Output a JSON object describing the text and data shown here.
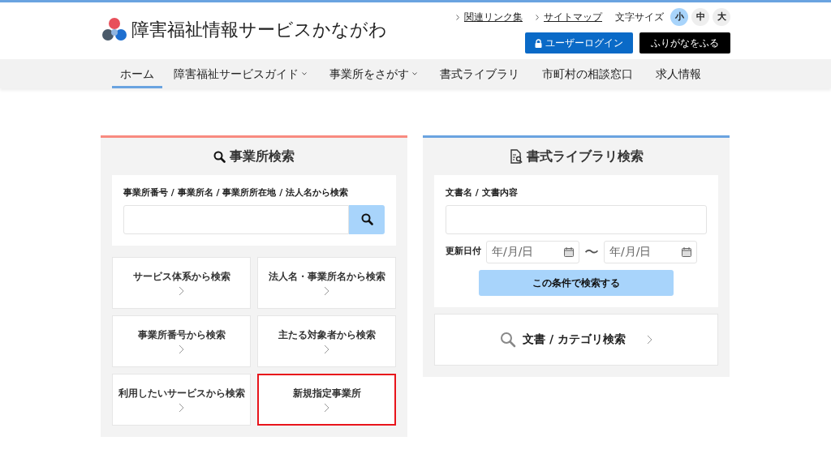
{
  "site_title": "障害福祉情報サービスかながわ",
  "top_links": [
    {
      "label": "関連リンク集"
    },
    {
      "label": "サイトマップ"
    }
  ],
  "font_size": {
    "label": "文字サイズ",
    "options": [
      {
        "label": "小",
        "selected": true
      },
      {
        "label": "中",
        "selected": false
      },
      {
        "label": "大",
        "selected": false
      }
    ]
  },
  "login_button": "ユーザーログイン",
  "furigana_button": "ふりがなをふる",
  "nav": [
    {
      "label": "ホーム",
      "selected": true,
      "dropdown": false
    },
    {
      "label": "障害福祉サービスガイド",
      "selected": false,
      "dropdown": true
    },
    {
      "label": "事業所をさがす",
      "selected": false,
      "dropdown": true
    },
    {
      "label": "書式ライブラリ",
      "selected": false,
      "dropdown": false
    },
    {
      "label": "市町村の相談窓口",
      "selected": false,
      "dropdown": false
    },
    {
      "label": "求人情報",
      "selected": false,
      "dropdown": false
    }
  ],
  "office_search": {
    "title": "事業所検索",
    "field_label": "事業所番号 / 事業所名 / 事業所所在地 / 法人名から検索",
    "tiles": [
      {
        "label": "サービス体系から検索",
        "highlighted": false
      },
      {
        "label": "法人名・事業所名から検索",
        "highlighted": false
      },
      {
        "label": "事業所番号から検索",
        "highlighted": false
      },
      {
        "label": "主たる対象者から検索",
        "highlighted": false
      },
      {
        "label": "利用したいサービスから検索",
        "highlighted": false
      },
      {
        "label": "新規指定事業所",
        "highlighted": true
      }
    ]
  },
  "library_search": {
    "title": "書式ライブラリ検索",
    "field_label": "文書名 / 文書内容",
    "date_label": "更新日付",
    "date_from": {
      "placeholder": "年/月/日"
    },
    "range_mark": "〜",
    "date_to": {
      "placeholder": "年/月/日"
    },
    "submit": "この条件で検索する",
    "category_link": "文書 / カテゴリ検索"
  }
}
